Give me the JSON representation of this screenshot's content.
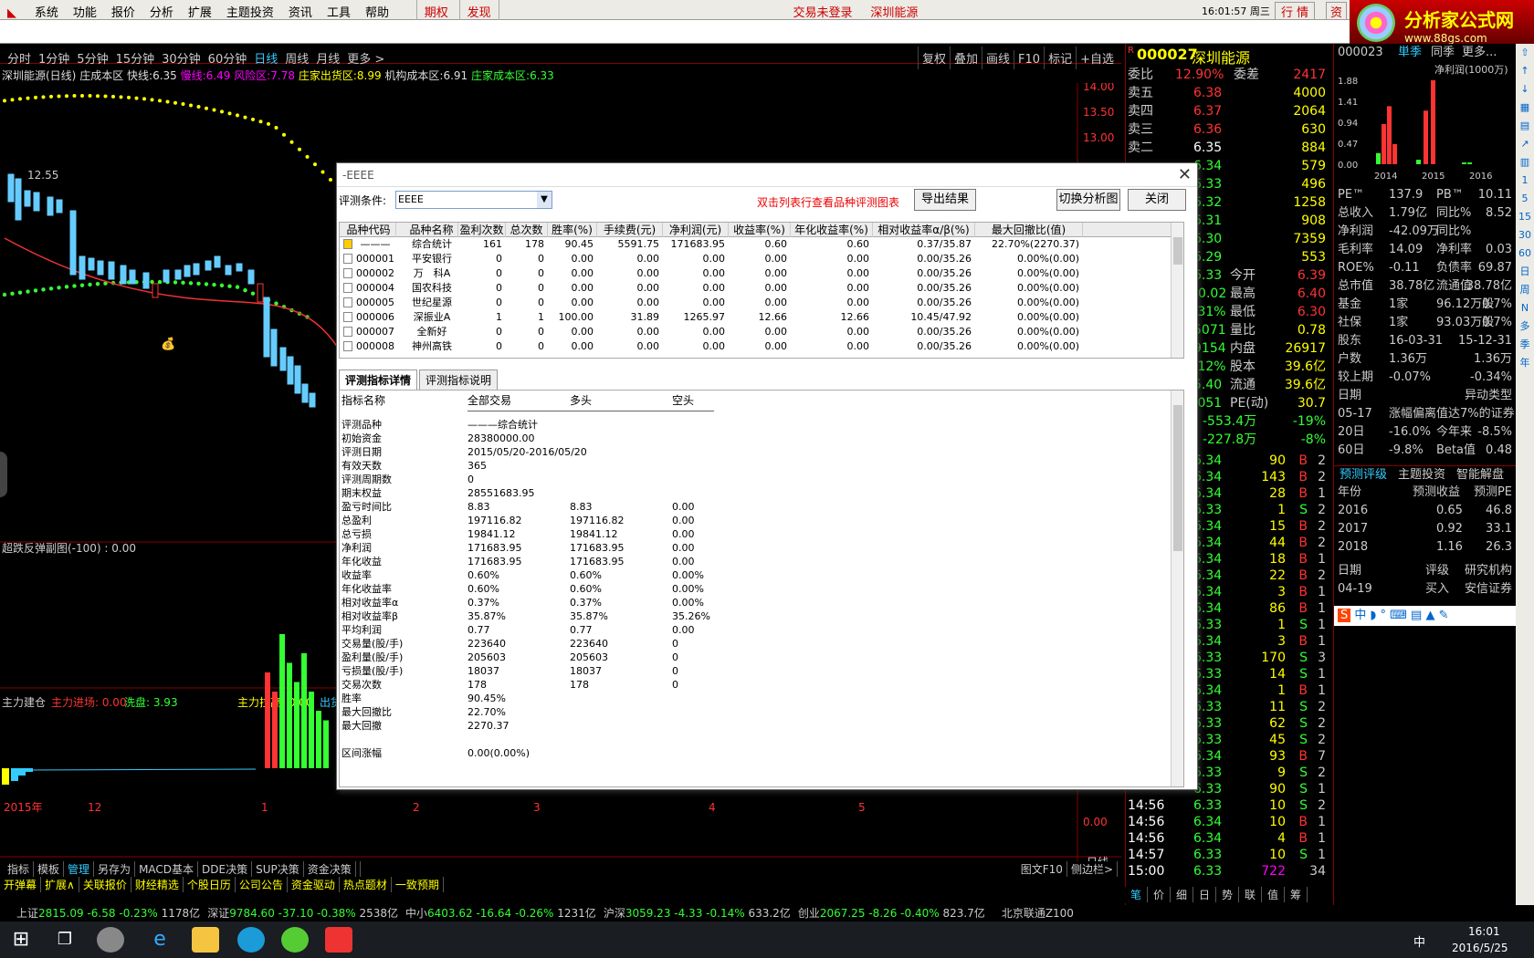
{
  "menu": {
    "items": [
      "系统",
      "功能",
      "报价",
      "分析",
      "扩展",
      "主题投资",
      "资讯",
      "工具",
      "帮助"
    ],
    "highlight": [
      "期权",
      "发现"
    ],
    "login_status": "交易未登录",
    "stock": "深圳能源",
    "time": "16:01:57 周三",
    "right_tabs": [
      "行",
      "情",
      "资"
    ]
  },
  "brand": {
    "title": "分析家公式网",
    "url": "www.88gs.com"
  },
  "timeframes": {
    "items": [
      "分时",
      "1分钟",
      "5分钟",
      "15分钟",
      "30分钟",
      "60分钟",
      "日线",
      "周线",
      "月线",
      "更多 >"
    ],
    "active": "日线",
    "right": [
      "复权",
      "叠加",
      "画线",
      "F10",
      "标记",
      "+自选"
    ]
  },
  "indicator": {
    "name": "深圳能源(日线)",
    "label1": "庄成本区",
    "fast_label": "快线:",
    "fast_val": "6.35",
    "slow_label": "慢线:",
    "slow_val": "6.49",
    "risk_label": "风险区:",
    "risk_val": "7.78",
    "out_label": "庄家出货区:",
    "out_val": "8.99",
    "inst_label": "机构成本区:",
    "inst_val": "6.91",
    "cost_label": "庄家成本区:",
    "cost_val": "6.33"
  },
  "chart_data": {
    "type": "candlestick",
    "price_ticks": [
      "14.00",
      "13.50",
      "13.00"
    ],
    "peak_label": "12.55",
    "sub1_label": "超跌反弹副图(-100) : 0.00",
    "sub2": {
      "label1": "主力建仓",
      "label2": "主力进场: 0.00",
      "label3": "洗盘: 3.93",
      "label4": "主力拉高: 0.00",
      "label5": "出货"
    },
    "sub2_tick": "0.00",
    "x_ticks": [
      "2015年",
      "12",
      "1",
      "2",
      "3",
      "4",
      "5"
    ],
    "period": "日线"
  },
  "quote": {
    "code": "000027",
    "name": "深圳能源",
    "ratio_label": "委比",
    "ratio": "12.90%",
    "diff_label": "委差",
    "diff": "2417",
    "asks": [
      {
        "l": "卖五",
        "p": "6.38",
        "v": "4000"
      },
      {
        "l": "卖四",
        "p": "6.37",
        "v": "2064"
      },
      {
        "l": "卖三",
        "p": "6.36",
        "v": "630"
      },
      {
        "l": "卖二",
        "p": "6.35",
        "v": "884"
      }
    ],
    "frags": [
      {
        "p": "6.34",
        "v": "579"
      },
      {
        "p": "6.33",
        "v": "496"
      },
      {
        "p": "6.32",
        "v": "1258"
      },
      {
        "p": "6.31",
        "v": "908"
      },
      {
        "p": "6.30",
        "v": "7359"
      },
      {
        "p": "6.29",
        "v": "553"
      }
    ],
    "stats": [
      {
        "a": "6.33",
        "l": "今开",
        "v": "6.39"
      },
      {
        "a": "-0.02",
        "l": "最高",
        "v": "6.40"
      },
      {
        "a": ".31%",
        "l": "最低",
        "v": "6.30"
      },
      {
        "a": "5071",
        "l": "量比",
        "v": "0.78"
      },
      {
        "a": "9154",
        "l": "内盘",
        "v": "26917"
      },
      {
        "a": ".12%",
        "l": "股本",
        "v": "39.6亿"
      },
      {
        "a": "5.40",
        "l": "流通",
        "v": "39.6亿"
      },
      {
        "a": ".051",
        "l": "PE(动)",
        "v": "30.7"
      }
    ],
    "flows": [
      {
        "v": "-553.4万",
        "p": "-19%"
      },
      {
        "v": "-227.8万",
        "p": "-8%"
      }
    ],
    "ticks": [
      [
        "",
        "6.34",
        "90",
        "B",
        "2"
      ],
      [
        "",
        "6.34",
        "143",
        "B",
        "2"
      ],
      [
        "",
        "6.34",
        "28",
        "B",
        "1"
      ],
      [
        "",
        "6.33",
        "1",
        "S",
        "2"
      ],
      [
        "",
        "6.34",
        "15",
        "B",
        "2"
      ],
      [
        "",
        "6.34",
        "44",
        "B",
        "2"
      ],
      [
        "",
        "6.34",
        "18",
        "B",
        "1"
      ],
      [
        "",
        "6.34",
        "22",
        "B",
        "2"
      ],
      [
        "",
        "6.34",
        "3",
        "B",
        "1"
      ],
      [
        "",
        "6.34",
        "86",
        "B",
        "1"
      ],
      [
        "",
        "6.33",
        "1",
        "S",
        "1"
      ],
      [
        "",
        "6.34",
        "3",
        "B",
        "1"
      ],
      [
        "",
        "6.33",
        "170",
        "S",
        "3"
      ],
      [
        "",
        "6.33",
        "14",
        "S",
        "1"
      ],
      [
        "",
        "6.34",
        "1",
        "B",
        "1"
      ],
      [
        "",
        "6.33",
        "11",
        "S",
        "2"
      ],
      [
        "",
        "6.33",
        "62",
        "S",
        "2"
      ],
      [
        "",
        "6.33",
        "45",
        "S",
        "2"
      ],
      [
        "",
        "6.34",
        "93",
        "B",
        "7"
      ],
      [
        "",
        "6.33",
        "9",
        "S",
        "2"
      ],
      [
        "",
        "6.33",
        "90",
        "S",
        "1"
      ],
      [
        "14:56",
        "6.33",
        "10",
        "S",
        "2"
      ],
      [
        "14:56",
        "6.34",
        "10",
        "B",
        "1"
      ],
      [
        "14:56",
        "6.34",
        "4",
        "B",
        "1"
      ],
      [
        "14:57",
        "6.33",
        "10",
        "S",
        "1"
      ],
      [
        "15:00",
        "6.33",
        "722",
        "",
        "34"
      ]
    ],
    "tabs": [
      "笔",
      "价",
      "细",
      "日",
      "势",
      "联",
      "值",
      "筹"
    ]
  },
  "fin": {
    "code": "000023",
    "tabs": [
      "単季",
      "同季",
      "更多..."
    ],
    "chart_title": "净利润(1000万)",
    "yticks": [
      "1.88",
      "1.41",
      "0.94",
      "0.47",
      "0.00"
    ],
    "years": [
      "2014",
      "2015",
      "2016"
    ],
    "rows": [
      [
        "PE™",
        "137.9",
        "PB™",
        "10.11"
      ],
      [
        "总收入",
        "1.79亿",
        "同比%",
        "8.52"
      ],
      [
        "净利润",
        "-42.09万",
        "同比%",
        ""
      ],
      [
        "毛利率",
        "14.09",
        "净利率",
        "0.03"
      ],
      [
        "ROE%",
        "-0.11",
        "负债率",
        "69.87"
      ],
      [
        "总市值",
        "38.78亿",
        "流通值",
        "38.78亿"
      ],
      [
        "基金",
        "1家",
        "96.12万股",
        "0.7%"
      ],
      [
        "社保",
        "1家",
        "93.03万股",
        "0.7%"
      ],
      [
        "股东",
        "16-03-31",
        "",
        "15-12-31"
      ],
      [
        "户数",
        "1.36万",
        "",
        "1.36万"
      ],
      [
        "较上期",
        "-0.07%",
        "",
        "-0.34%"
      ],
      [
        "日期",
        "",
        "",
        "异动类型"
      ],
      [
        "05-17",
        "涨幅偏离值达7%的证券",
        "",
        ""
      ],
      [
        "20日",
        "-16.0%",
        "今年来",
        "-8.5%"
      ],
      [
        "60日",
        "-9.8%",
        "Beta值",
        "0.48"
      ]
    ],
    "rating_tabs": [
      "预测评级",
      "主题投资",
      "智能解盘"
    ],
    "rating_head": [
      "年份",
      "预测收益",
      "预测PE"
    ],
    "ratings": [
      [
        "2016",
        "0.65",
        "46.8"
      ],
      [
        "2017",
        "0.92",
        "33.1"
      ],
      [
        "2018",
        "1.16",
        "26.3"
      ]
    ],
    "org_head": [
      "日期",
      "评级",
      "研究机构"
    ],
    "org": [
      "04-19",
      "买入",
      "安信证券"
    ]
  },
  "side": [
    "1",
    "5",
    "15",
    "30",
    "60",
    "日",
    "周",
    "N",
    "多",
    "季",
    "年"
  ],
  "dialog": {
    "title": "-EEEE",
    "cond_label": "评测条件:",
    "cond_value": "EEEE",
    "hint": "双击列表行查看品种评测图表",
    "export": "导出结果",
    "switch": "切换分析图",
    "close": "关闭",
    "cols": [
      "品种代码",
      "品种名称",
      "盈利次数",
      "总次数",
      "胜率(%)",
      "手续费(元)",
      "净利润(元)",
      "收益率(%)",
      "年化收益率(%)",
      "相对收益率α/β(%)",
      "最大回撤比(值)"
    ],
    "rows": [
      [
        "———",
        "综合统计",
        "161",
        "178",
        "90.45",
        "5591.75",
        "171683.95",
        "0.60",
        "0.60",
        "0.37/35.87",
        "22.70%(2270.37)"
      ],
      [
        "000001",
        "平安银行",
        "0",
        "0",
        "0.00",
        "0.00",
        "0.00",
        "0.00",
        "0.00",
        "0.00/35.26",
        "0.00%(0.00)"
      ],
      [
        "000002",
        "万　科A",
        "0",
        "0",
        "0.00",
        "0.00",
        "0.00",
        "0.00",
        "0.00",
        "0.00/35.26",
        "0.00%(0.00)"
      ],
      [
        "000004",
        "国农科技",
        "0",
        "0",
        "0.00",
        "0.00",
        "0.00",
        "0.00",
        "0.00",
        "0.00/35.26",
        "0.00%(0.00)"
      ],
      [
        "000005",
        "世纪星源",
        "0",
        "0",
        "0.00",
        "0.00",
        "0.00",
        "0.00",
        "0.00",
        "0.00/35.26",
        "0.00%(0.00)"
      ],
      [
        "000006",
        "深振业A",
        "1",
        "1",
        "100.00",
        "31.89",
        "1265.97",
        "12.66",
        "12.66",
        "10.45/47.92",
        "0.00%(0.00)"
      ],
      [
        "000007",
        "全新好",
        "0",
        "0",
        "0.00",
        "0.00",
        "0.00",
        "0.00",
        "0.00",
        "0.00/35.26",
        "0.00%(0.00)"
      ],
      [
        "000008",
        "神州高铁",
        "0",
        "0",
        "0.00",
        "0.00",
        "0.00",
        "0.00",
        "0.00",
        "0.00/35.26",
        "0.00%(0.00)"
      ]
    ],
    "tabs": [
      "评测指标详情",
      "评测指标说明"
    ],
    "detail_head": [
      "指标名称",
      "全部交易",
      "多头",
      "空头"
    ],
    "detail": [
      [
        "评测品种",
        "———综合统计",
        "",
        ""
      ],
      [
        "初始资金",
        "28380000.00",
        "",
        ""
      ],
      [
        "评测日期",
        "2015/05/20-2016/05/20",
        "",
        ""
      ],
      [
        "有效天数",
        "365",
        "",
        ""
      ],
      [
        "评测周期数",
        "0",
        "",
        ""
      ],
      [
        "期末权益",
        "28551683.95",
        "",
        ""
      ],
      [
        "盈亏时间比",
        "8.83",
        "8.83",
        "0.00"
      ],
      [
        "总盈利",
        "197116.82",
        "197116.82",
        "0.00"
      ],
      [
        "总亏损",
        "19841.12",
        "19841.12",
        "0.00"
      ],
      [
        "净利润",
        "171683.95",
        "171683.95",
        "0.00"
      ],
      [
        "年化收益",
        "171683.95",
        "171683.95",
        "0.00"
      ],
      [
        "收益率",
        "0.60%",
        "0.60%",
        "0.00%"
      ],
      [
        "年化收益率",
        "0.60%",
        "0.60%",
        "0.00%"
      ],
      [
        "相对收益率α",
        "0.37%",
        "0.37%",
        "0.00%"
      ],
      [
        "相对收益率β",
        "35.87%",
        "35.87%",
        "35.26%"
      ],
      [
        "平均利润",
        "0.77",
        "0.77",
        "0.00"
      ],
      [
        "交易量(股/手)",
        "223640",
        "223640",
        "0"
      ],
      [
        "盈利量(股/手)",
        "205603",
        "205603",
        "0"
      ],
      [
        "亏损量(股/手)",
        "18037",
        "18037",
        "0"
      ],
      [
        "交易次数",
        "178",
        "178",
        "0"
      ],
      [
        "胜率",
        "90.45%",
        "",
        ""
      ],
      [
        "最大回撤比",
        "22.70%",
        "",
        ""
      ],
      [
        "最大回撤",
        "2270.37",
        "",
        ""
      ],
      [
        "",
        "",
        "",
        ""
      ],
      [
        "区间涨幅",
        "0.00(0.00%)",
        "",
        ""
      ]
    ]
  },
  "bottom1": [
    "指标",
    "模板",
    "管理",
    "另存为",
    "MACD基本",
    "DDE决策",
    "SUP决策",
    "资金决策"
  ],
  "bottom1_right": [
    "图文F10",
    "侧边栏>"
  ],
  "bottom2": [
    "开弹幕",
    "扩展∧",
    "关联报价",
    "财经精选",
    "个股日历",
    "公司公告",
    "资金驱动",
    "热点题材",
    "一致预期"
  ],
  "status": [
    {
      "n": "上证",
      "v": "2815.09",
      "c": "-6.58",
      "p": "-0.23%",
      "a": "1178亿"
    },
    {
      "n": "深证",
      "v": "9784.60",
      "c": "-37.10",
      "p": "-0.38%",
      "a": "2538亿"
    },
    {
      "n": "中小",
      "v": "6403.62",
      "c": "-16.64",
      "p": "-0.26%",
      "a": "1231亿"
    },
    {
      "n": "沪深",
      "v": "3059.23",
      "c": "-4.33",
      "p": "-0.14%",
      "a": "633.2亿"
    },
    {
      "n": "创业",
      "v": "2067.25",
      "c": "-8.26",
      "p": "-0.40%",
      "a": "823.7亿"
    }
  ],
  "status_right": "北京联通Z100",
  "taskbar": {
    "time": "16:01",
    "date": "2016/5/25",
    "ime": "中"
  }
}
